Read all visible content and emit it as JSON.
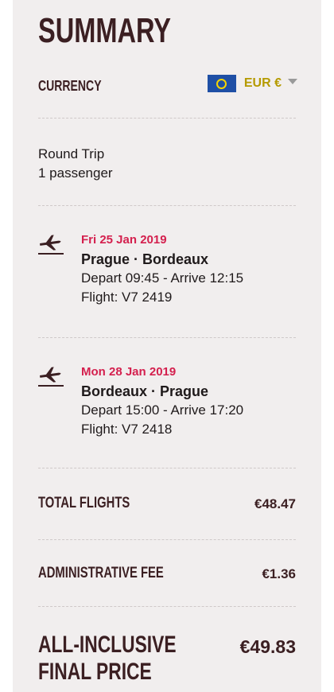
{
  "summary": {
    "title": "SUMMARY",
    "currency_label": "CURRENCY",
    "currency_value": "EUR €",
    "trip_type": "Round Trip",
    "passengers": "1 passenger"
  },
  "flights": [
    {
      "date": "Fri 25 Jan 2019",
      "route": "Prague · Bordeaux",
      "times": "Depart 09:45 - Arrive 12:15",
      "flight": "Flight: V7 2419"
    },
    {
      "date": "Mon 28 Jan 2019",
      "route": "Bordeaux · Prague",
      "times": "Depart 15:00 - Arrive 17:20",
      "flight": "Flight: V7 2418"
    }
  ],
  "totals": {
    "flights_label": "TOTAL FLIGHTS",
    "flights_value": "€48.47",
    "fee_label": "ADMINISTRATIVE FEE",
    "fee_value": "€1.36",
    "final_label": "ALL-INCLUSIVE FINAL PRICE",
    "final_value": "€49.83"
  },
  "colors": {
    "accent_date": "#d4204e",
    "heading": "#3b1f22",
    "currency": "#b59a00",
    "panel": "#f1eeee"
  }
}
